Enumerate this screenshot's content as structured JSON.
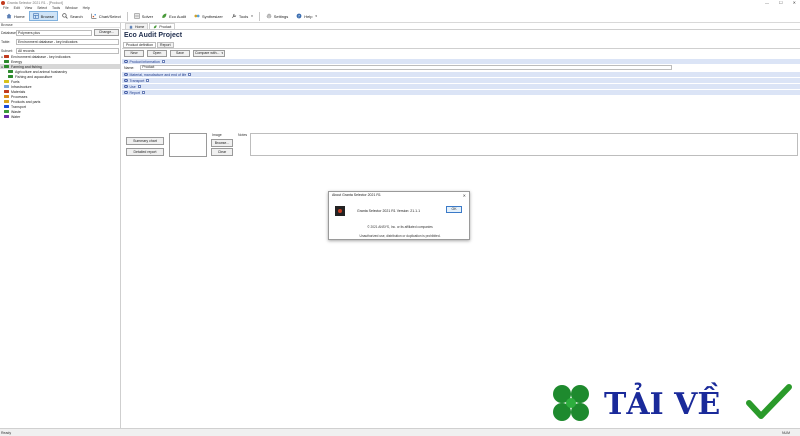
{
  "window": {
    "title": "Granta Selector 2021 R1 - [Product]",
    "controls": [
      "—",
      "☐",
      "✕"
    ]
  },
  "menu": [
    "File",
    "Edit",
    "View",
    "Select",
    "Tools",
    "Window",
    "Help"
  ],
  "toolbar": {
    "items": [
      {
        "label": "Home",
        "icon": "home-icon",
        "active": false
      },
      {
        "label": "Browse",
        "icon": "browse-icon",
        "active": true
      },
      {
        "label": "Search",
        "icon": "search-icon",
        "active": false
      },
      {
        "label": "Chart/Select",
        "icon": "chart-icon",
        "active": false
      },
      {
        "label": "Solver",
        "icon": "solver-icon",
        "active": false
      },
      {
        "label": "Eco Audit",
        "icon": "eco-audit-icon",
        "active": false
      },
      {
        "label": "Synthesizer",
        "icon": "synthesizer-icon",
        "active": false
      },
      {
        "label": "Tools",
        "icon": "tools-icon",
        "active": false,
        "dropdown": true
      },
      {
        "label": "Settings",
        "icon": "gear-icon",
        "active": false
      },
      {
        "label": "Help",
        "icon": "help-icon",
        "active": false,
        "dropdown": true
      }
    ]
  },
  "browse_panel": {
    "title": "Browse",
    "database_label": "Database:",
    "database_value": "Polymers plus",
    "change_label": "Change...",
    "table_label": "Table:",
    "table_value": "Environment database - key indicators",
    "subset_label": "Subset:",
    "subset_value": "All records",
    "tree": [
      {
        "label": "Environment database - key indicators",
        "level": 0,
        "color": "#c23a1e",
        "expanded": true,
        "selected": false
      },
      {
        "label": "Energy",
        "level": 1,
        "color": "#2e8b2e",
        "selected": false
      },
      {
        "label": "Farming and fishing",
        "level": 1,
        "color": "#2e8b2e",
        "expanded": true,
        "selected": true
      },
      {
        "label": "Agriculture and animal husbandry",
        "level": 2,
        "color": "#2e8b2e",
        "selected": false
      },
      {
        "label": "Fishing and aquaculture",
        "level": 2,
        "color": "#2e8b2e",
        "selected": false
      },
      {
        "label": "Fuels",
        "level": 1,
        "color": "#d8c21a",
        "selected": false
      },
      {
        "label": "Infrastructure",
        "level": 1,
        "color": "#7fa7d8",
        "selected": false
      },
      {
        "label": "Materials",
        "level": 1,
        "color": "#c23a1e",
        "selected": false
      },
      {
        "label": "Processes",
        "level": 1,
        "color": "#d88a1a",
        "selected": false
      },
      {
        "label": "Products and parts",
        "level": 1,
        "color": "#d8a21a",
        "selected": false
      },
      {
        "label": "Transport",
        "level": 1,
        "color": "#1a4ad8",
        "selected": false
      },
      {
        "label": "Waste",
        "level": 1,
        "color": "#3a9a3a",
        "selected": false
      },
      {
        "label": "Water",
        "level": 1,
        "color": "#6a2aa8",
        "selected": false
      }
    ]
  },
  "tabs": [
    {
      "label": "Home",
      "active": false
    },
    {
      "label": "Product",
      "active": true
    }
  ],
  "project": {
    "title": "Eco Audit Project",
    "subtabs": [
      {
        "label": "Product definition",
        "active": true
      },
      {
        "label": "Report",
        "active": false
      }
    ],
    "actions": {
      "new": "New",
      "open": "Open",
      "save": "Save",
      "compare": "Compare with..."
    },
    "sections": {
      "product_info": "Product information",
      "material": "Material, manufacture and end of life",
      "transport": "Transport",
      "use": "Use",
      "report": "Report"
    },
    "name_label": "Name:",
    "name_value": "Product",
    "summary_chart": "Summary chart",
    "detailed_report": "Detailed report",
    "image_label": "Image",
    "browse_btn": "Browse...",
    "clear_btn": "Clear",
    "notes_label": "Notes"
  },
  "about_dialog": {
    "title": "About Granta Selector 2021 R1",
    "version": "Granta Selector 2021 R1 Version: 21.1.1",
    "ok": "OK",
    "copyright": "© 2021 ANSYS, Inc. or its affiliated companies",
    "unauthorized": "Unauthorized use, distribution or duplication is prohibited."
  },
  "statusbar": {
    "left": "Ready",
    "right": "NUM"
  },
  "watermark": {
    "text": "TẢI VỀ"
  }
}
